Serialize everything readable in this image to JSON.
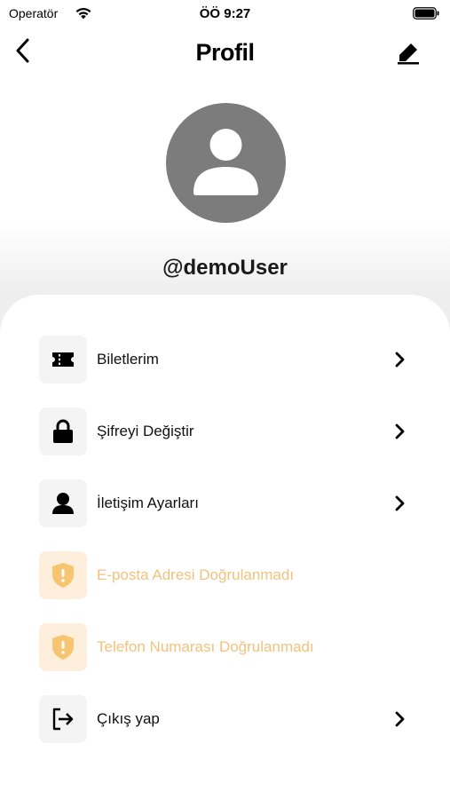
{
  "status_bar": {
    "carrier": "Operatör",
    "time": "ÖÖ 9:27"
  },
  "header": {
    "title": "Profil"
  },
  "profile": {
    "username": "@demoUser"
  },
  "menu": {
    "items": [
      {
        "label": "Biletlerim",
        "icon": "ticket-icon",
        "warning": false
      },
      {
        "label": "Şifreyi Değiştir",
        "icon": "lock-icon",
        "warning": false
      },
      {
        "label": "İletişim Ayarları",
        "icon": "person-icon",
        "warning": false
      },
      {
        "label": "E-posta Adresi Doğrulanmadı",
        "icon": "shield-warning-icon",
        "warning": true
      },
      {
        "label": "Telefon Numarası Doğrulanmadı",
        "icon": "shield-warning-icon",
        "warning": true
      },
      {
        "label": "Çıkış yap",
        "icon": "logout-icon",
        "warning": false
      }
    ]
  },
  "colors": {
    "warning_text": "#f3c27c",
    "warning_icon": "#f7c56f",
    "warning_bg": "#fdefdc",
    "avatar_bg": "#7c7c7c"
  }
}
